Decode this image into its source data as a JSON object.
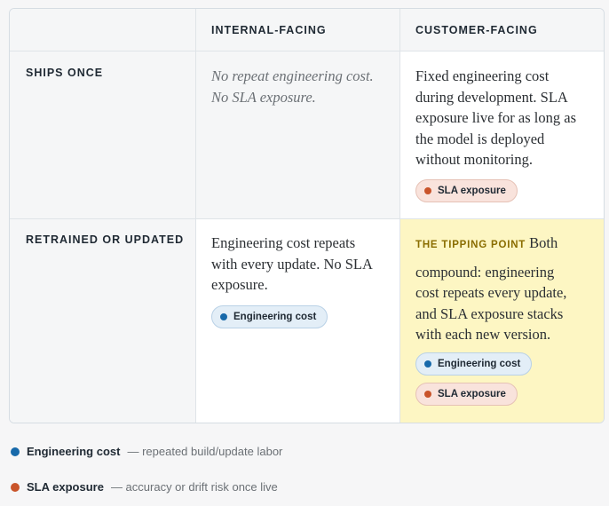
{
  "matrix": {
    "columns": [
      "INTERNAL-FACING",
      "CUSTOMER-FACING"
    ],
    "rows": [
      "SHIPS ONCE",
      "RETRAINED OR UPDATED"
    ],
    "cells": {
      "ships_once_internal": {
        "text_line1": "No repeat engineering cost.",
        "text_line2": "No SLA exposure."
      },
      "ships_once_customer": {
        "text_line1": "Fixed engineering cost",
        "text_line2": "during development. SLA",
        "text_line3": "exposure live for as long as",
        "text_line4": "the model is deployed",
        "text_line5": "without monitoring.",
        "tag": "SLA exposure"
      },
      "retrained_internal": {
        "text_line1": "Engineering cost repeats",
        "text_line2": "with every update. No SLA",
        "text_line3": "exposure.",
        "tag": "Engineering cost"
      },
      "retrained_customer": {
        "label": "THE TIPPING POINT",
        "text_line1": "Both",
        "text_line2": "compound: engineering",
        "text_line3": "cost repeats every update,",
        "text_line4": "and SLA exposure stacks",
        "text_line5": "with each new version.",
        "tag1": "Engineering cost",
        "tag2": "SLA exposure"
      }
    }
  },
  "legend": [
    {
      "name": "Engineering cost",
      "description": "— repeated build/update labor",
      "color": "#1769aa"
    },
    {
      "name": "SLA exposure",
      "description": "— accuracy or drift risk once live",
      "color": "#c9542a"
    }
  ],
  "colors": {
    "tipping_point_background": "#fdf6c3",
    "engineering": "#1769aa",
    "sla": "#c9542a"
  }
}
